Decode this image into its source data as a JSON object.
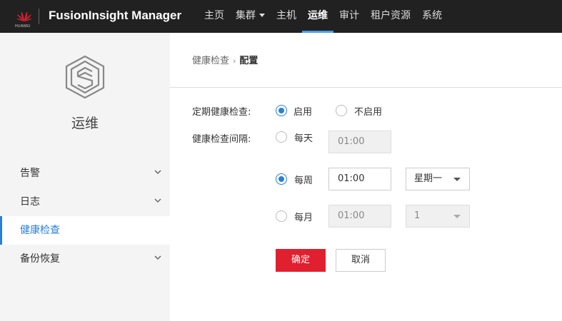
{
  "header": {
    "brand_small": "HUAWEI",
    "app_title": "FusionInsight Manager",
    "nav": [
      {
        "label": "主页"
      },
      {
        "label": "集群"
      },
      {
        "label": "主机"
      },
      {
        "label": "运维"
      },
      {
        "label": "审计"
      },
      {
        "label": "租户资源"
      },
      {
        "label": "系统"
      }
    ],
    "active_nav": "运维"
  },
  "sidebar": {
    "module_title": "运维",
    "items": [
      {
        "label": "告警"
      },
      {
        "label": "日志"
      },
      {
        "label": "健康检查"
      },
      {
        "label": "备份恢复"
      }
    ],
    "active_item": "健康检查"
  },
  "breadcrumb": {
    "parent": "健康检查",
    "separator": "›",
    "current": "配置"
  },
  "form": {
    "schedule_label": "定期健康检查:",
    "enable_label": "启用",
    "disable_label": "不启用",
    "schedule_value": "启用",
    "interval_label": "健康检查间隔:",
    "interval_value": "每周",
    "daily": {
      "label": "每天",
      "time": "01:00"
    },
    "weekly": {
      "label": "每周",
      "time": "01:00",
      "weekday": "星期一"
    },
    "monthly": {
      "label": "每月",
      "time": "01:00",
      "day": "1"
    },
    "confirm_label": "确定",
    "cancel_label": "取消"
  },
  "colors": {
    "topbar_bg": "#212121",
    "accent_blue": "#2a7fd6",
    "primary_red": "#e0202e",
    "sidebar_bg": "#f4f4f4"
  }
}
